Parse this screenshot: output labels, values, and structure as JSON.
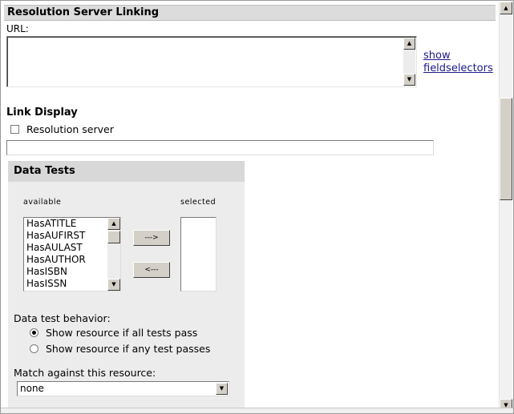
{
  "section": {
    "title": "Resolution Server Linking"
  },
  "url": {
    "label": "URL:",
    "value": ""
  },
  "show_fieldselectors": {
    "line1": "show",
    "line2": "fieldselectors"
  },
  "link_display": {
    "heading": "Link Display",
    "checkbox_label": "Resolution server",
    "checked": false,
    "text_value": ""
  },
  "data_tests": {
    "title": "Data Tests",
    "available_label": "available",
    "selected_label": "selected",
    "available": [
      "HasATITLE",
      "HasAUFIRST",
      "HasAULAST",
      "HasAUTHOR",
      "HasISBN",
      "HasISSN"
    ],
    "selected": [],
    "add_button": "--->",
    "remove_button": "<---"
  },
  "behavior": {
    "label": "Data test behavior:",
    "options": [
      "Show resource if all tests pass",
      "Show resource if any test passes"
    ],
    "selected_index": 0
  },
  "match": {
    "label": "Match against this resource:",
    "value": "none"
  },
  "icons": {
    "scroll_up": "▲",
    "scroll_down": "▼"
  }
}
